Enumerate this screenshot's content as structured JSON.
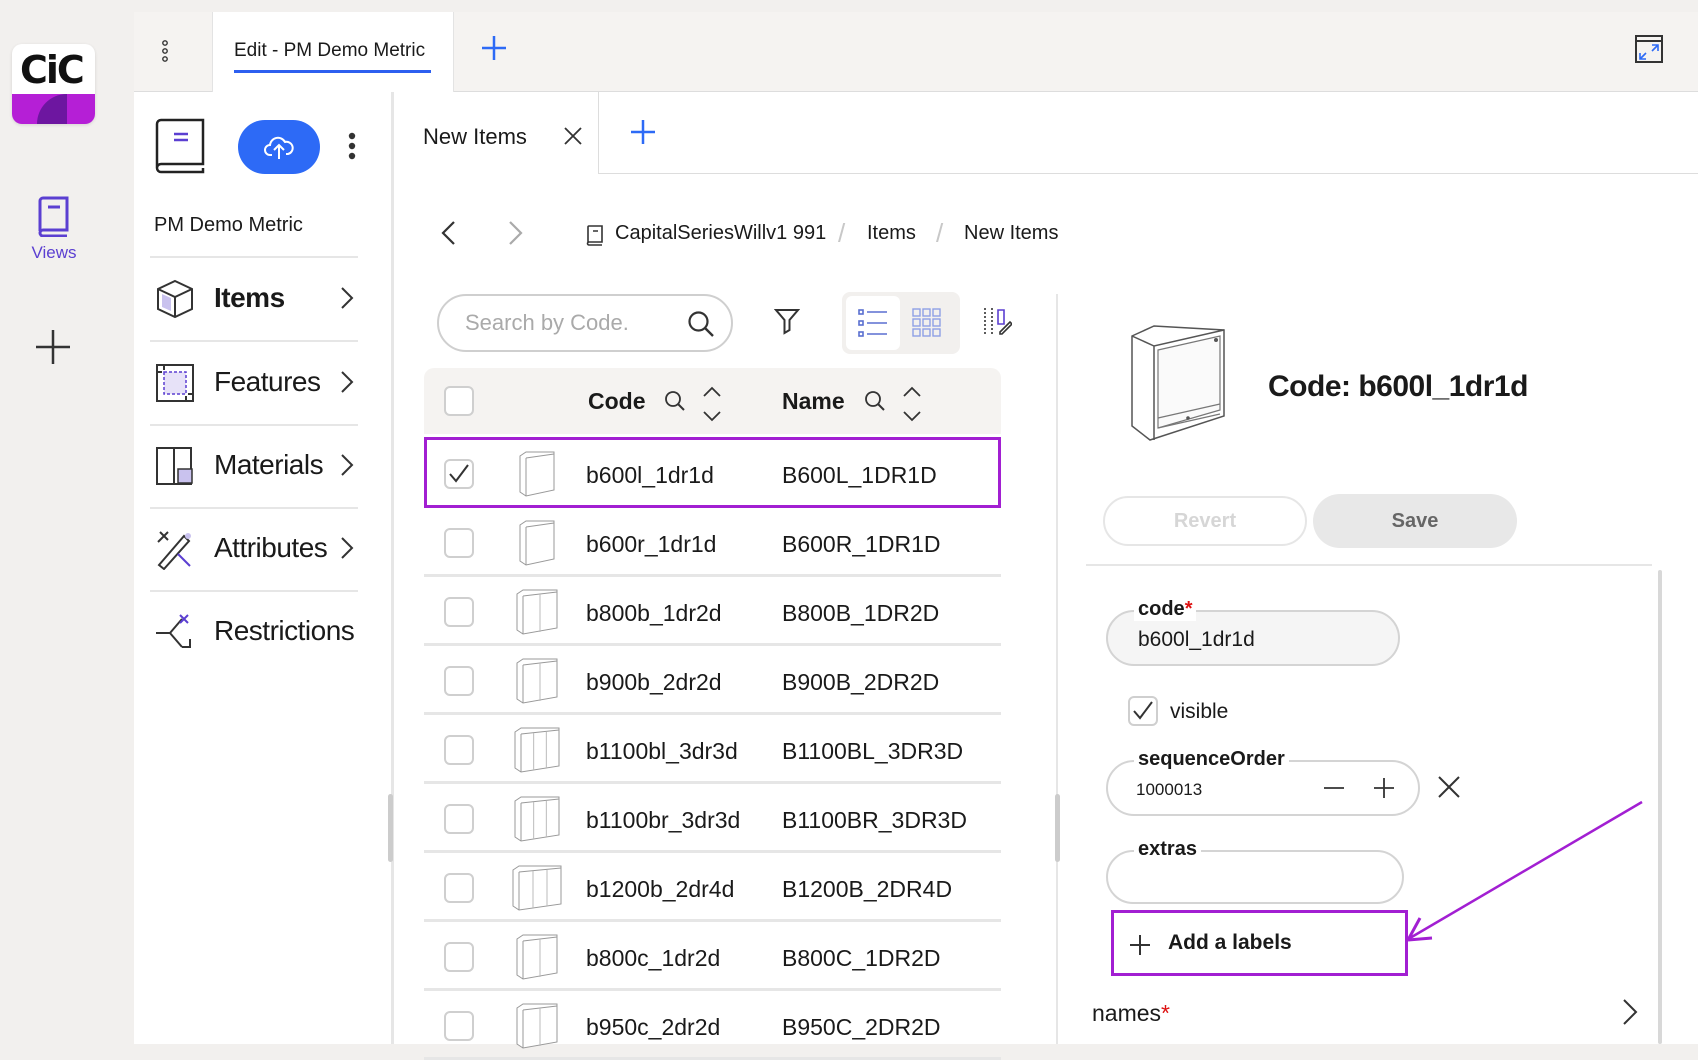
{
  "app": {
    "logo_text": "CiC",
    "rail": {
      "views_label": "Views"
    },
    "window_tab": "Edit - PM Demo Metric"
  },
  "nav": {
    "project_name": "PM Demo Metric",
    "items": [
      {
        "label": "Items",
        "icon": "cube-icon",
        "active": true
      },
      {
        "label": "Features",
        "icon": "features-icon",
        "active": false
      },
      {
        "label": "Materials",
        "icon": "materials-icon",
        "active": false
      },
      {
        "label": "Attributes",
        "icon": "attributes-icon",
        "active": false
      },
      {
        "label": "Restrictions",
        "icon": "restrictions-icon",
        "active": false
      }
    ]
  },
  "content": {
    "tab_label": "New Items",
    "breadcrumb": [
      "CapitalSeriesWillv1 991",
      "Items",
      "New Items"
    ],
    "search": {
      "placeholder": "Search by Code.",
      "value": ""
    },
    "table": {
      "columns": [
        "Code",
        "Name"
      ],
      "rows": [
        {
          "code": "b600l_1dr1d",
          "name": "B600L_1DR1D",
          "checked": true
        },
        {
          "code": "b600r_1dr1d",
          "name": "B600R_1DR1D",
          "checked": false
        },
        {
          "code": "b800b_1dr2d",
          "name": "B800B_1DR2D",
          "checked": false
        },
        {
          "code": "b900b_2dr2d",
          "name": "B900B_2DR2D",
          "checked": false
        },
        {
          "code": "b1100bl_3dr3d",
          "name": "B1100BL_3DR3D",
          "checked": false
        },
        {
          "code": "b1100br_3dr3d",
          "name": "B1100BR_3DR3D",
          "checked": false
        },
        {
          "code": "b1200b_2dr4d",
          "name": "B1200B_2DR4D",
          "checked": false
        },
        {
          "code": "b800c_1dr2d",
          "name": "B800C_1DR2D",
          "checked": false
        },
        {
          "code": "b950c_2dr2d",
          "name": "B950C_2DR2D",
          "checked": false
        }
      ]
    }
  },
  "detail": {
    "title": "Code: b600l_1dr1d",
    "revert_label": "Revert",
    "save_label": "Save",
    "code_label": "code",
    "code_value": "b600l_1dr1d",
    "visible_label": "visible",
    "visible_checked": true,
    "sequence_label": "sequenceOrder",
    "sequence_value": "1000013",
    "extras_label": "extras",
    "extras_value": "",
    "add_labels": "Add a labels",
    "names_label": "names",
    "required_mark": "*"
  },
  "colors": {
    "accent_blue": "#2d6af6",
    "highlight_purple": "#a21fd2",
    "brand_purple": "#b51fd6",
    "views_purple": "#5b3fd1"
  }
}
